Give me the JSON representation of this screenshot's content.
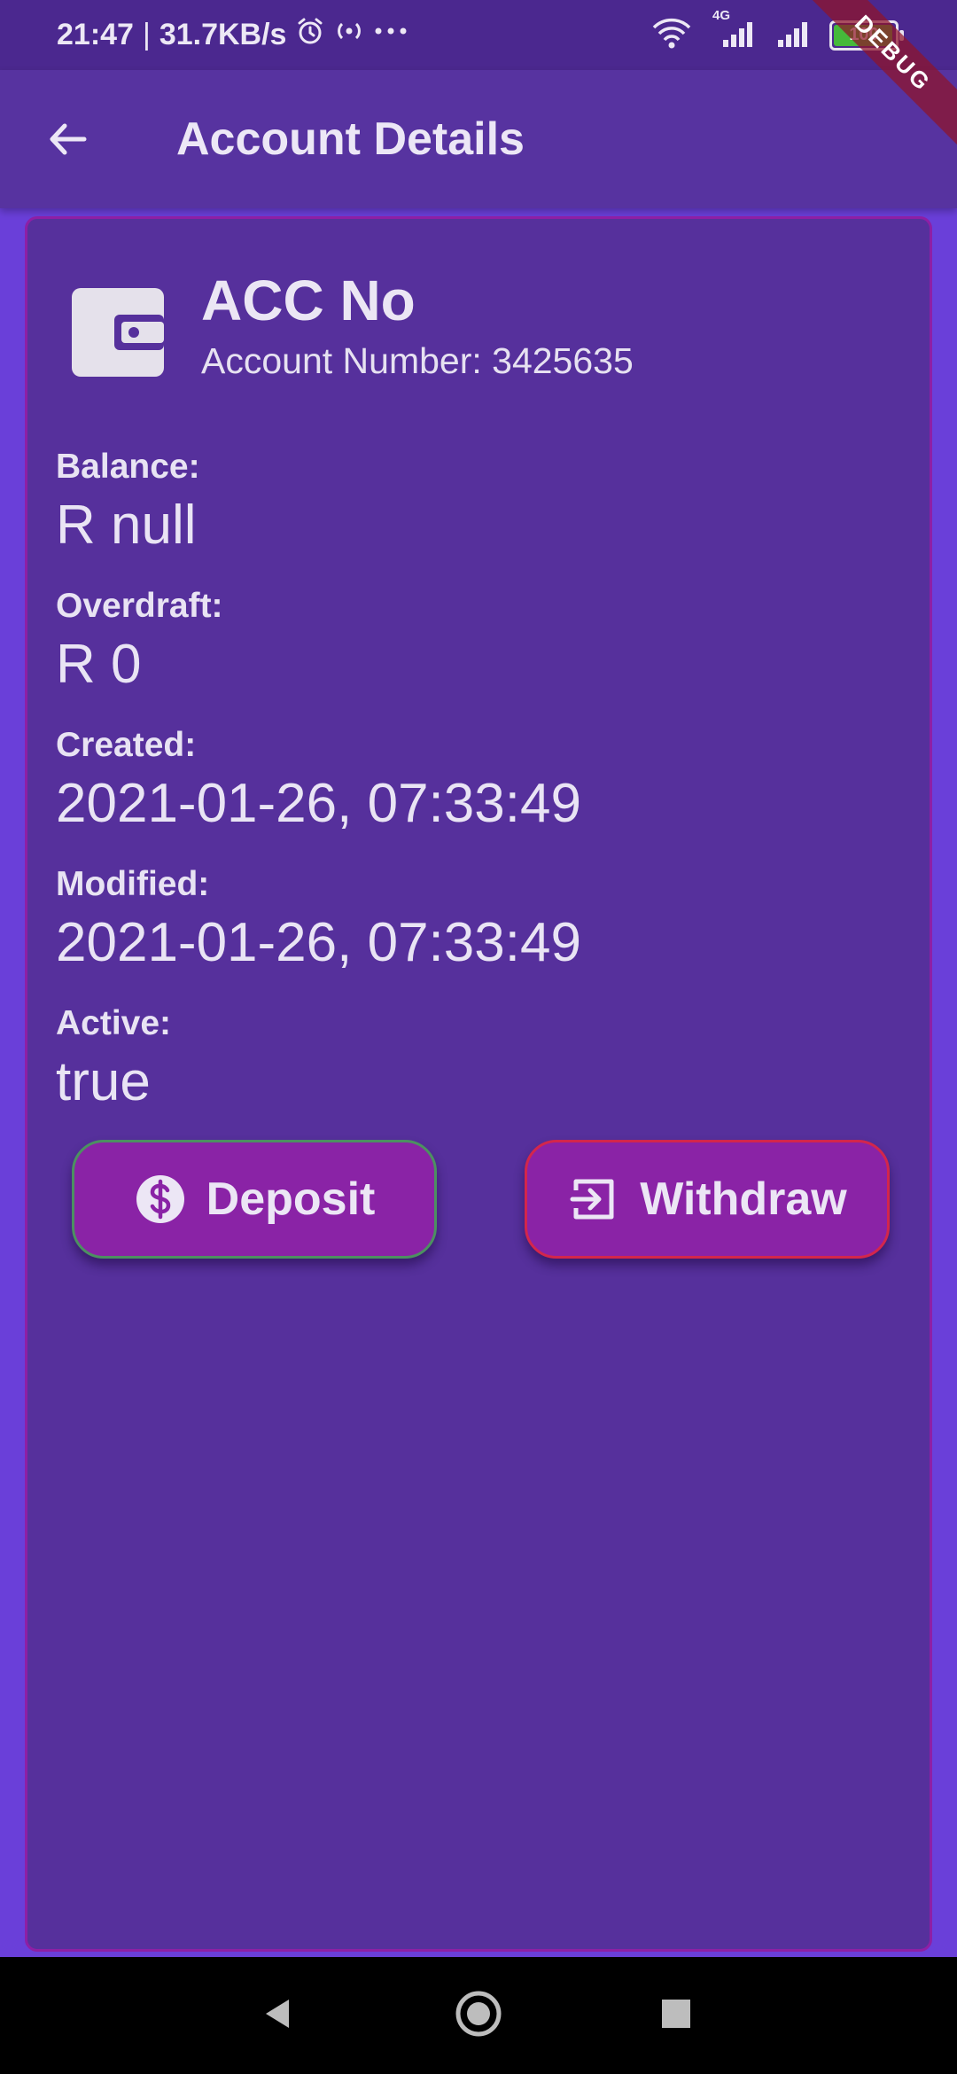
{
  "status_bar": {
    "time": "21:47",
    "separator": "|",
    "net_speed": "31.7KB/s",
    "network_type": "4G",
    "battery_level": "100",
    "icons": [
      "alarm-icon",
      "hotspot-icon",
      "more-dots-icon",
      "wifi-icon",
      "signal-icon",
      "signal-icon",
      "battery-icon",
      "charging-icon"
    ]
  },
  "debug_banner": "DEBUG",
  "app_bar": {
    "title": "Account Details",
    "back_icon": "arrow-back-icon"
  },
  "account": {
    "icon": "wallet-icon",
    "title": "ACC No",
    "number_text": "Account Number: 3425635"
  },
  "fields": {
    "balance": {
      "label": "Balance:",
      "value": "R null"
    },
    "overdraft": {
      "label": "Overdraft:",
      "value": "R 0"
    },
    "created": {
      "label": "Created:",
      "value": "2021-01-26, 07:33:49"
    },
    "modified": {
      "label": "Modified:",
      "value": "2021-01-26, 07:33:49"
    },
    "active": {
      "label": "Active:",
      "value": "true"
    }
  },
  "actions": {
    "deposit": {
      "label": "Deposit",
      "icon": "dollar-circle-icon",
      "border_color": "#4c9061"
    },
    "withdraw": {
      "label": "Withdraw",
      "icon": "exit-box-icon",
      "border_color": "#d3264c"
    }
  },
  "colors": {
    "background": "#6a3fd9",
    "app_bar": "#5733a0",
    "status_bar": "#4b288f",
    "card": "#56309c",
    "card_border": "#8e1fa5",
    "button": "#8a23a6"
  },
  "nav_bar": {
    "back_icon": "nav-back-triangle-icon",
    "home_icon": "nav-home-circle-icon",
    "recents_icon": "nav-recents-square-icon"
  }
}
